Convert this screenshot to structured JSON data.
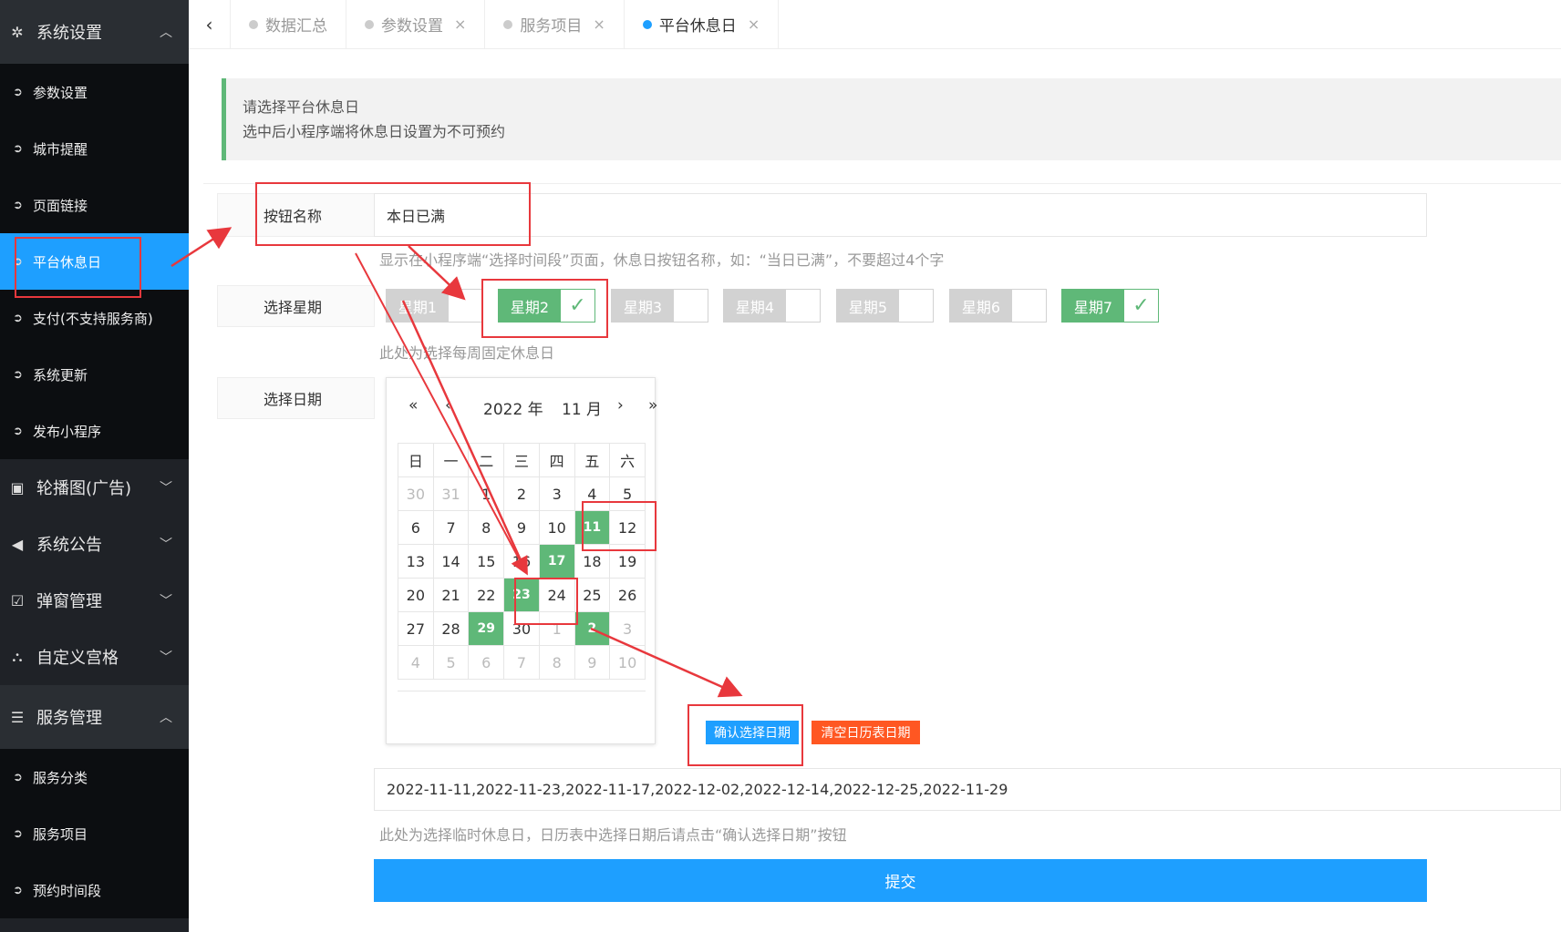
{
  "sidebar": {
    "group_system": "系统设置",
    "system_items": [
      "参数设置",
      "城市提醒",
      "页面链接",
      "平台休息日",
      "支付(不支持服务商)",
      "系统更新",
      "发布小程序"
    ],
    "groups": [
      "轮播图(广告)",
      "系统公告",
      "弹窗管理",
      "自定义宫格"
    ],
    "group_service": "服务管理",
    "service_items": [
      "服务分类",
      "服务项目",
      "预约时间段"
    ]
  },
  "tabs": [
    {
      "label": "数据汇总",
      "closable": false
    },
    {
      "label": "参数设置",
      "closable": true
    },
    {
      "label": "服务项目",
      "closable": true
    },
    {
      "label": "平台休息日",
      "closable": true
    }
  ],
  "notice": {
    "line1": "请选择平台休息日",
    "line2": "选中后小程序端将休息日设置为不可预约"
  },
  "form": {
    "button_name_label": "按钮名称",
    "button_name_value": "本日已满",
    "button_name_help": "显示在小程序端“选择时间段”页面，休息日按钮名称，如：“当日已满”，不要超过4个字",
    "week_label": "选择星期",
    "weekdays": [
      {
        "label": "星期1",
        "checked": false
      },
      {
        "label": "星期2",
        "checked": true
      },
      {
        "label": "星期3",
        "checked": false
      },
      {
        "label": "星期4",
        "checked": false
      },
      {
        "label": "星期5",
        "checked": false
      },
      {
        "label": "星期6",
        "checked": false
      },
      {
        "label": "星期7",
        "checked": true
      }
    ],
    "week_help": "此处为选择每周固定休息日",
    "date_label": "选择日期",
    "dates_value": "2022-11-11,2022-11-23,2022-11-17,2022-12-02,2022-12-14,2022-12-25,2022-11-29",
    "dates_help": "此处为选择临时休息日，日历表中选择日期后请点击“确认选择日期”按钮",
    "confirm_button": "确认选择日期",
    "clear_button": "清空日历表日期",
    "submit_button": "提交"
  },
  "calendar": {
    "year": "2022 年",
    "month": "11 月",
    "weekday_headers": [
      "日",
      "一",
      "二",
      "三",
      "四",
      "五",
      "六"
    ],
    "rows": [
      [
        "30",
        "31",
        "1",
        "2",
        "3",
        "4",
        "5"
      ],
      [
        "6",
        "7",
        "8",
        "9",
        "10",
        "11",
        "12"
      ],
      [
        "13",
        "14",
        "15",
        "16",
        "17",
        "18",
        "19"
      ],
      [
        "20",
        "21",
        "22",
        "23",
        "24",
        "25",
        "26"
      ],
      [
        "27",
        "28",
        "29",
        "30",
        "1",
        "2",
        "3"
      ],
      [
        "4",
        "5",
        "6",
        "7",
        "8",
        "9",
        "10"
      ]
    ],
    "other_month": [
      [
        0,
        0
      ],
      [
        0,
        1
      ],
      [
        4,
        4
      ],
      [
        4,
        5
      ],
      [
        4,
        6
      ],
      [
        5,
        0
      ],
      [
        5,
        1
      ],
      [
        5,
        2
      ],
      [
        5,
        3
      ],
      [
        5,
        4
      ],
      [
        5,
        5
      ],
      [
        5,
        6
      ]
    ],
    "selected": [
      [
        1,
        5
      ],
      [
        2,
        4
      ],
      [
        3,
        3
      ],
      [
        4,
        2
      ],
      [
        4,
        5
      ]
    ]
  },
  "colors": {
    "accent": "#1e9fff",
    "green": "#5fb878",
    "warn": "#ff5722",
    "annotation": "#e8383d"
  }
}
